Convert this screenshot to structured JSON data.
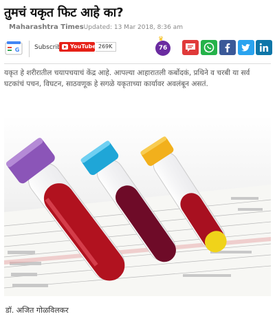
{
  "article": {
    "headline": "तुमचं यकृत फिट आहे का?",
    "source": "Maharashtra Times",
    "updated": "Updated: 13 Mar 2018, 8:36 am",
    "summary": "यकृत हे शरीरातील चयापचयाचं केंद्र आहे. आपल्या आहारातली कर्बोदकं, प्रथिने व चरबी या सर्व घटकांचं पचन, विघटन, साठवणूक हे सगळे यकृताच्या कार्यावर अवलंबून असतं.",
    "author": "डॉ. अजित गोळविलकर"
  },
  "toolbar": {
    "gnews_label": "G",
    "subscribe_label": "Subscribe",
    "youtube_label": "YouTube",
    "youtube_count": "269K",
    "badge_count": "76"
  },
  "icons": [
    "google-news-icon",
    "youtube-play-icon",
    "crown-icon",
    "comment-icon",
    "whatsapp-icon",
    "facebook-icon",
    "twitter-icon",
    "linkedin-icon"
  ],
  "colors": {
    "youtube": "#e62117",
    "comment": "#e03a3a",
    "whatsapp": "#25b24a",
    "facebook": "#3b5998",
    "twitter": "#2aa3ef",
    "linkedin": "#0e76a8",
    "badge": "#6a2ba0"
  }
}
